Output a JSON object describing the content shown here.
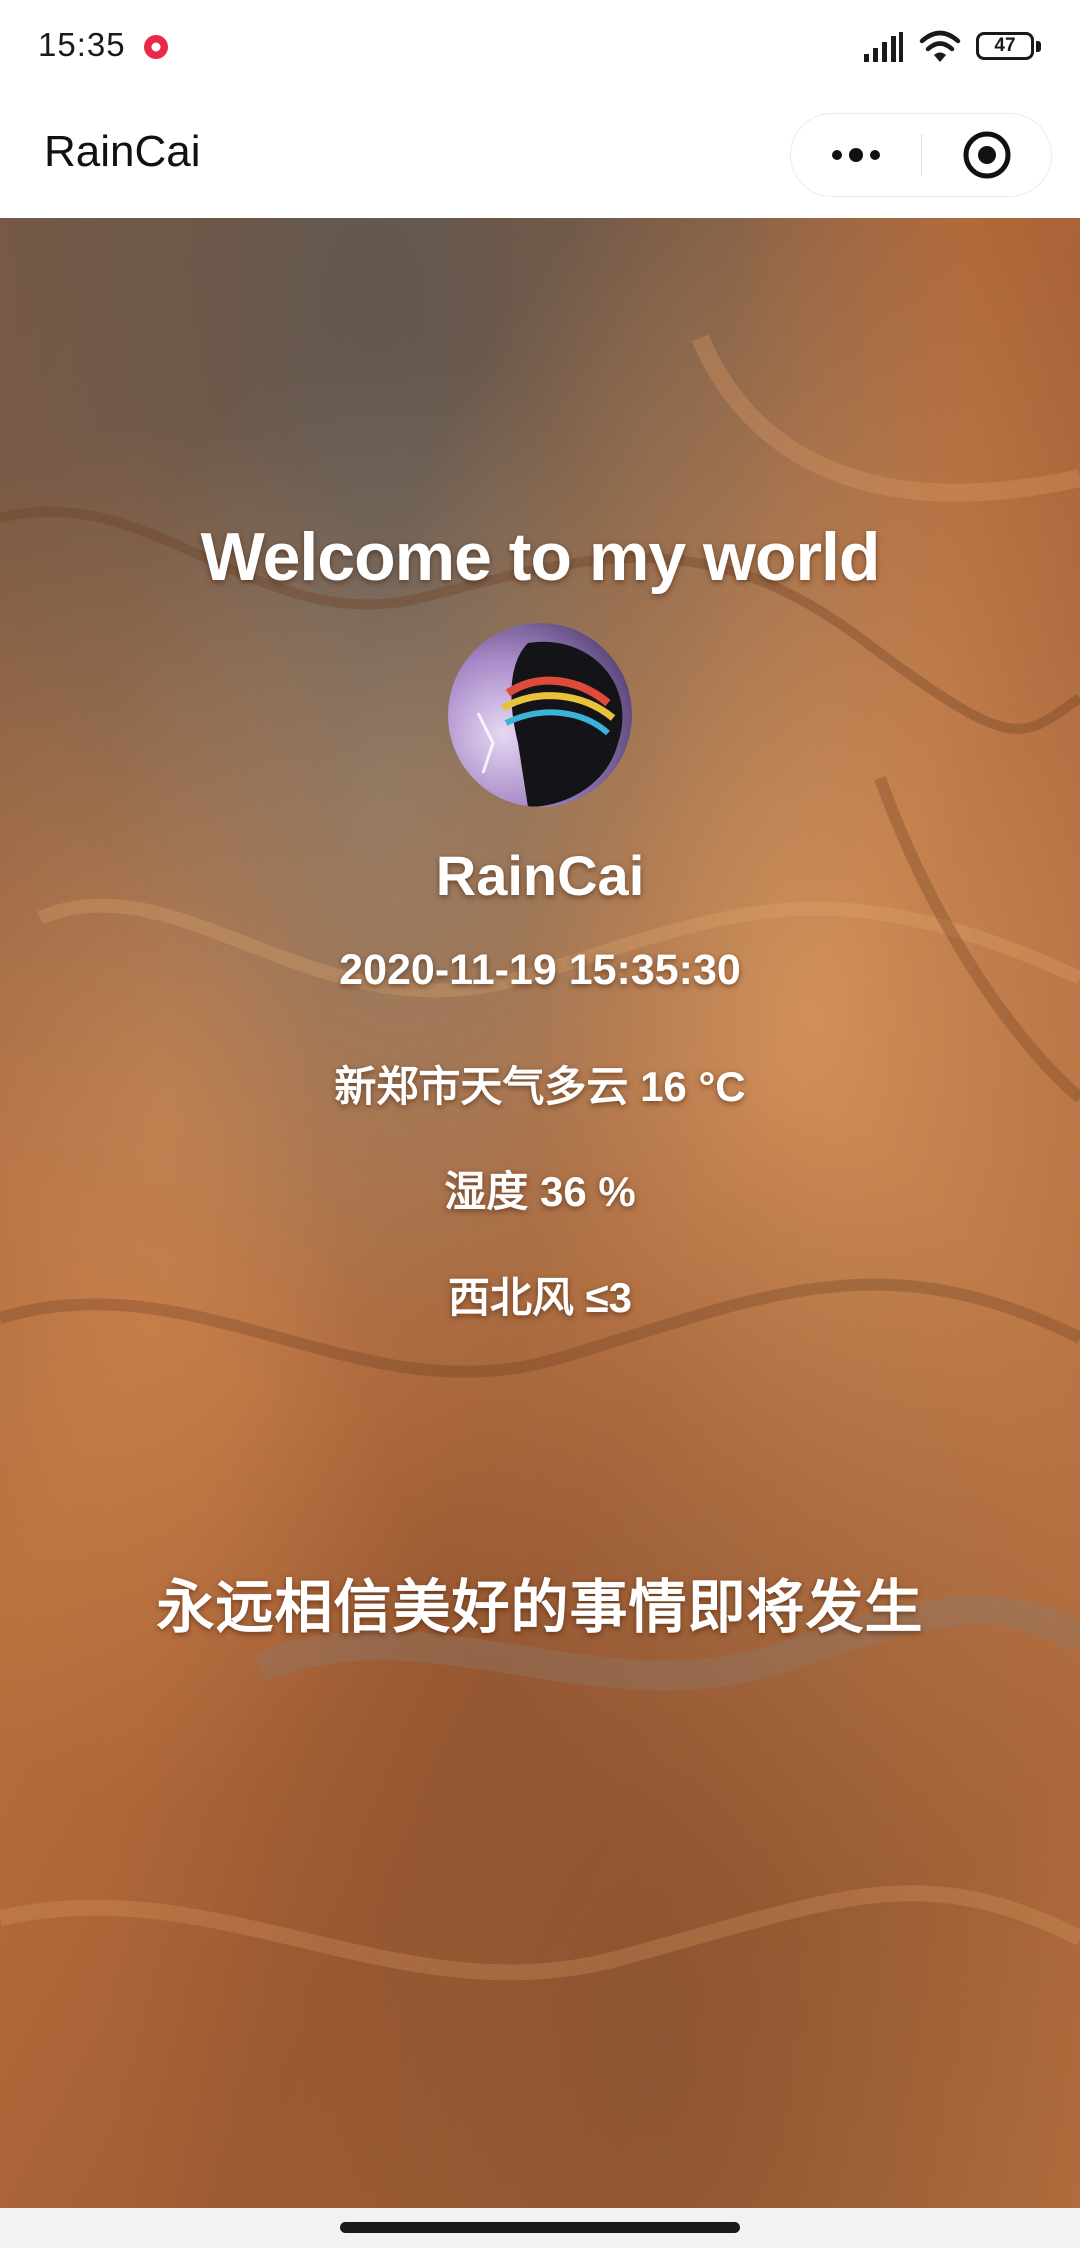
{
  "status_bar": {
    "time": "15:35",
    "battery": "47",
    "icons": [
      "notification-icon",
      "signal-icon",
      "wifi-icon",
      "battery-icon"
    ]
  },
  "nav_bar": {
    "title": "RainCai",
    "more_icon": "more-dots-icon",
    "close_icon": "target-close-icon"
  },
  "main": {
    "welcome": "Welcome to my world",
    "username": "RainCai",
    "datetime": "2020-11-19 15:35:30",
    "weather": "新郑市天气多云 16 °C",
    "humidity": "湿度 36 %",
    "wind": "西北风 ≤3",
    "motto": "永远相信美好的事情即将发生"
  },
  "colors": {
    "text": "#ffffff",
    "accent_notification": "#e8294a",
    "terrain_base": "#b4693a",
    "terrain_dark": "#5e4a40",
    "terrain_light": "#e3a468"
  }
}
